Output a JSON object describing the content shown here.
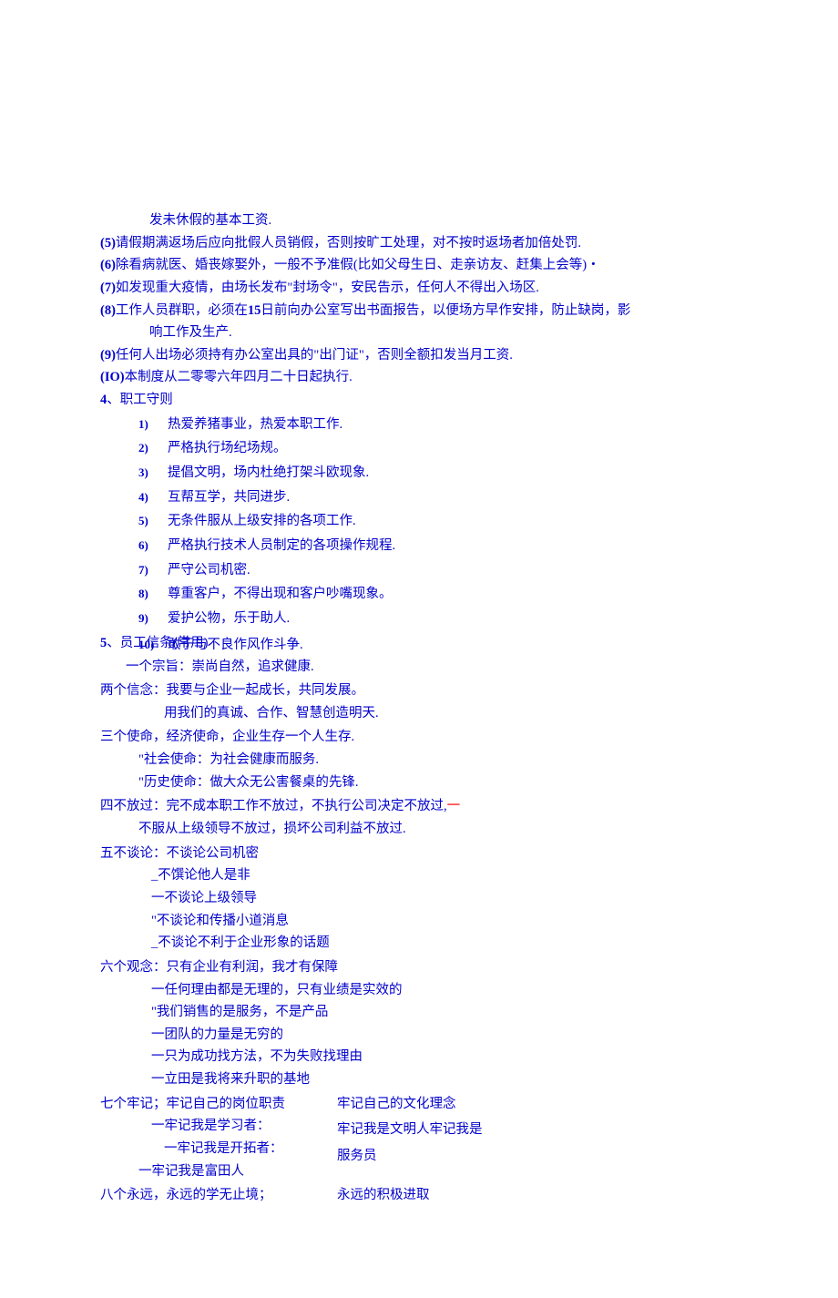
{
  "items": {
    "i5_cont": "发未休假的基本工资.",
    "i5": {
      "n": "(5)",
      "t": "请假期满返场后应向批假人员销假，否则按旷工处理，对不按时返场者加倍处罚."
    },
    "i6": {
      "n": "(6)",
      "t": "除看病就医、婚丧嫁娶外，一般不予准假(比如父母生日、走亲访友、赶集上会等)・"
    },
    "i7": {
      "n": "(7)",
      "t": "如发现重大疫情，由场长发布\"封场令\"，安民告示，任何人不得出入场区."
    },
    "i8": {
      "n": "(8)",
      "t": "工作人员群职，必须在",
      "t_bold": "15",
      "t2": "日前向办公室写出书面报告，以便场方早作安排，防止缺岗，影",
      "t3": "响工作及生产."
    },
    "i9": {
      "n": "(9)",
      "t": "任何人出场必须持有办公室出具的\"出门证\"，否则全额扣发当月工资."
    },
    "i10": {
      "n": "(IO)",
      "t": "本制度从二零零六年四月二十日起执行."
    }
  },
  "section4": {
    "num": "4",
    "sep": "、",
    "title": "职工守则"
  },
  "rules": [
    {
      "n": "1)",
      "t": "热爱养猪事业，热爱本职工作."
    },
    {
      "n": "2)",
      "t": "严格执行场纪场规。"
    },
    {
      "n": "3)",
      "t": "提倡文明，场内杜绝打架斗欧现象."
    },
    {
      "n": "4)",
      "t": "互帮互学，共同进步."
    },
    {
      "n": "5)",
      "t": "无条件服从上级安排的各项工作."
    },
    {
      "n": "6)",
      "t": "严格执行技术人员制定的各项操作规程."
    },
    {
      "n": "7)",
      "t": "严守公司机密."
    },
    {
      "n": "8)",
      "t": "尊重客户，不得出现和客户吵嘴现象。"
    },
    {
      "n": "9)",
      "t": "爱护公物，乐于助人."
    },
    {
      "n": "10)",
      "t": "敢于与不良作风作斗争."
    }
  ],
  "section5": {
    "num": "5",
    "sep": "、",
    "title": "员工信条(常用)"
  },
  "motto1": {
    "label": "一个宗旨：",
    "t": "崇尚自然，追求健康."
  },
  "motto2": {
    "label": "两个信念：",
    "t1": "我要与企业一起成长，共同发展。",
    "t2": "用我们的真诚、合作、智慧创造明天."
  },
  "motto3": {
    "label": "三个使命，",
    "t1": "经济使命，企业生存一个人生存.",
    "t2": "\"社会使命：为社会健康而服务.",
    "t3": "\"历史使命：做大众无公害餐桌的先锋."
  },
  "motto4": {
    "label": "四不放过：",
    "t1": "完不成本职工作不放过，不执行公司决定不放过,",
    "red": "一",
    "t2": "不服从上级领导不放过，损坏公司利益不放过."
  },
  "motto5": {
    "label": "五不谈论：",
    "t1": "不谈论公司机密",
    "items": [
      "_不馔论他人是非",
      "一不谈论上级领导",
      "\"不谈论和传播小道消息",
      "_不谈论不利于企业形象的话题"
    ]
  },
  "motto6": {
    "label": "六个观念：",
    "t1": "只有企业有利润，我才有保障",
    "items": [
      "一任何理由都是无理的，只有业绩是实效的",
      "\"我们销售的是服务，不是产品",
      "一团队的力量是无穷的",
      "一只为成功找方法，不为失败找理由",
      "一立田是我将来升职的基地"
    ]
  },
  "motto7": {
    "label": "七个牢记；",
    "t1": "牢记自己的岗位职责",
    "left": [
      "一牢记我是学习者：",
      "一牢记我是开拓者：",
      "一牢记我是富田人"
    ],
    "right": [
      "牢记自己的文化理念",
      "牢记我是文明人牢记我是",
      "服务员"
    ]
  },
  "motto8": {
    "label": "八个永远，",
    "t1": "永远的学无止境；",
    "right": "永远的积极进取"
  }
}
